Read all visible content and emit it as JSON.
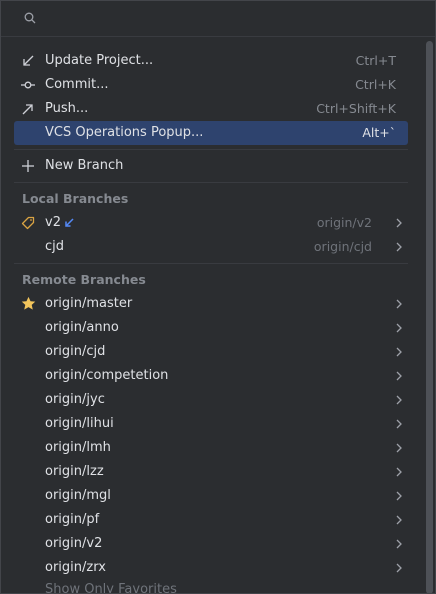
{
  "search": {
    "placeholder": ""
  },
  "actions": [
    {
      "label": "Update Project...",
      "shortcut": "Ctrl+T",
      "icon": "arrow-down-left-icon"
    },
    {
      "label": "Commit...",
      "shortcut": "Ctrl+K",
      "icon": "commit-icon"
    },
    {
      "label": "Push...",
      "shortcut": "Ctrl+Shift+K",
      "icon": "arrow-up-right-icon"
    },
    {
      "label": "VCS Operations Popup...",
      "shortcut": "Alt+`",
      "selected": true
    }
  ],
  "new_branch": {
    "label": "New Branch",
    "icon": "plus-icon"
  },
  "local_branches": {
    "header": "Local Branches",
    "items": [
      {
        "name": "v2",
        "tracking": "origin/v2",
        "icon": "tag-icon",
        "incoming": true
      },
      {
        "name": "cjd",
        "tracking": "origin/cjd"
      }
    ]
  },
  "remote_branches": {
    "header": "Remote Branches",
    "items": [
      {
        "name": "origin/master",
        "favorite": true
      },
      {
        "name": "origin/anno"
      },
      {
        "name": "origin/cjd"
      },
      {
        "name": "origin/competetion"
      },
      {
        "name": "origin/jyc"
      },
      {
        "name": "origin/lihui"
      },
      {
        "name": "origin/lmh"
      },
      {
        "name": "origin/lzz"
      },
      {
        "name": "origin/mgl"
      },
      {
        "name": "origin/pf"
      },
      {
        "name": "origin/v2"
      },
      {
        "name": "origin/zrx"
      }
    ]
  },
  "footer": {
    "label": "Show Only Favorites"
  },
  "colors": {
    "selection": "#2e436e",
    "star": "#f2c55c",
    "tag": "#d9a343",
    "incoming": "#548af7"
  }
}
